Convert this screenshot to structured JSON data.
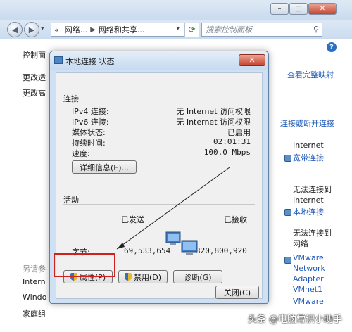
{
  "explorer": {
    "caption": {
      "minimize": "–",
      "maximize": "□",
      "close": "✕"
    },
    "nav": {
      "back": "◀",
      "forward": "▶",
      "recent": "▾"
    },
    "address": {
      "prefix": "«",
      "segments": [
        "网络...",
        "网络和共享..."
      ],
      "dropdown": "▾",
      "refresh": "⟳"
    },
    "search": {
      "placeholder": "搜索控制面板",
      "icon": "⚲"
    },
    "help": "?",
    "left_pane": {
      "items": [
        "控制面",
        "更改适",
        "更改高"
      ],
      "see_also_title": "另请参",
      "see_also": [
        "Interne",
        "Windo",
        "家庭组"
      ]
    },
    "right_pane": {
      "view_full_map": "查看完整映射",
      "connect_disconnect": "连接或断开连接",
      "sections": [
        {
          "label_lines": [
            "Internet"
          ],
          "link": "宽带连接"
        },
        {
          "label_lines": [
            "无法连接到",
            "Internet"
          ],
          "link": "本地连接"
        },
        {
          "label_lines": [
            "无法连接到",
            "网络"
          ],
          "link_lines": [
            "VMware",
            "Network",
            "Adapter",
            "VMnet1"
          ],
          "extra": "VMware"
        }
      ]
    }
  },
  "dialog": {
    "title": "本地连接 状态",
    "close": "✕",
    "connection": {
      "heading": "连接",
      "rows": [
        {
          "label": "IPv4 连接:",
          "value": "无 Internet 访问权限"
        },
        {
          "label": "IPv6 连接:",
          "value": "无 Internet 访问权限"
        },
        {
          "label": "媒体状态:",
          "value": "已启用"
        },
        {
          "label": "持续时间:",
          "value": "02:01:31"
        },
        {
          "label": "速度:",
          "value": "100.0 Mbps"
        }
      ],
      "details_button": "详细信息(E)..."
    },
    "activity": {
      "heading": "活动",
      "sent_label": "已发送",
      "received_label": "已接收",
      "bytes_label": "字节:",
      "bytes_sent": "69,533,654",
      "bytes_received": "320,800,920"
    },
    "buttons": {
      "properties": "属性(P)",
      "disable": "禁用(D)",
      "diagnose": "诊断(G)",
      "close": "关闭(C)"
    }
  },
  "watermark": "头条 @电脑常识小助手",
  "colors": {
    "highlight": "#d0211c",
    "link": "#1f59b8",
    "dialog_frame": "#cfe0f4"
  }
}
